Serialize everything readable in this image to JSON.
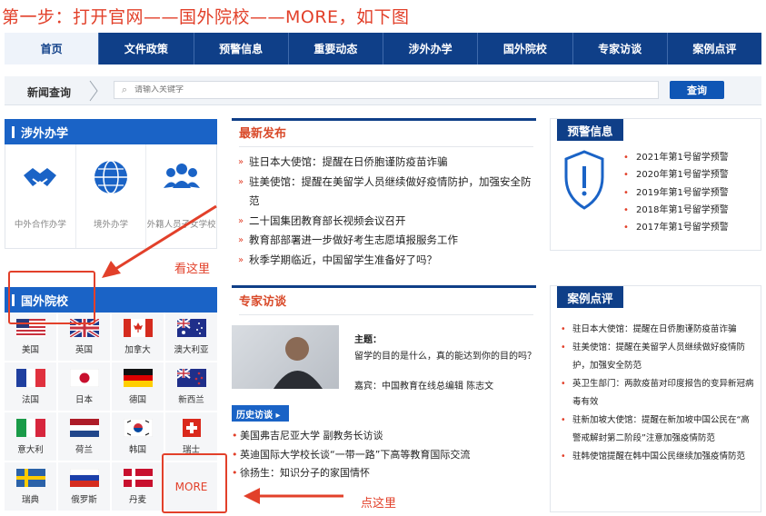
{
  "page_title": "第一步：打开官网——国外院校——MORE，如下图",
  "nav": [
    {
      "label": "首页"
    },
    {
      "label": "文件政策"
    },
    {
      "label": "预警信息"
    },
    {
      "label": "重要动态"
    },
    {
      "label": "涉外办学"
    },
    {
      "label": "国外院校"
    },
    {
      "label": "专家访谈"
    },
    {
      "label": "案例点评"
    }
  ],
  "search": {
    "label": "新闻查询",
    "placeholder": "请输入关键字",
    "button": "查询"
  },
  "abroad": {
    "title": "涉外办学",
    "items": [
      {
        "label": "中外合作办学",
        "icon": "handshake-icon"
      },
      {
        "label": "境外办学",
        "icon": "globe-icon"
      },
      {
        "label": "外籍人员子女学校",
        "icon": "people-icon"
      }
    ]
  },
  "schools": {
    "title": "国外院校",
    "flags": [
      {
        "name": "美国"
      },
      {
        "name": "英国"
      },
      {
        "name": "加拿大"
      },
      {
        "name": "澳大利亚"
      },
      {
        "name": "法国"
      },
      {
        "name": "日本"
      },
      {
        "name": "德国"
      },
      {
        "name": "新西兰"
      },
      {
        "name": "意大利"
      },
      {
        "name": "荷兰"
      },
      {
        "name": "韩国"
      },
      {
        "name": "瑞士"
      },
      {
        "name": "瑞典"
      },
      {
        "name": "俄罗斯"
      },
      {
        "name": "丹麦"
      }
    ],
    "more": "MORE"
  },
  "annotations": {
    "look_here": "看这里",
    "click_here": "点这里",
    "color": "#e2402a"
  },
  "news": {
    "title": "最新发布",
    "items": [
      "驻日本大使馆：提醒在日侨胞谨防疫苗诈骗",
      "驻美使馆：提醒在美留学人员继续做好疫情防护，加强安全防范",
      "二十国集团教育部长视频会议召开",
      "教育部部署进一步做好考生志愿填报服务工作",
      "秋季学期临近，中国留学生准备好了吗？"
    ]
  },
  "expert": {
    "title": "专家访谈",
    "topic_label": "主题：",
    "topic": "留学的目的是什么，真的能达到你的目的吗？",
    "guest": "嘉宾：中国教育在线总编辑 陈志文",
    "history_btn": "历史访谈 ▸",
    "history": [
      "美国弗吉尼亚大学 副教务长访谈",
      "英迪国际大学校长谈“一带一路”下高等教育国际交流",
      "徐扬生：知识分子的家国情怀"
    ]
  },
  "warnings": {
    "title": "预警信息",
    "items": [
      "2021年第1号留学预警",
      "2020年第1号留学预警",
      "2019年第1号留学预警",
      "2018年第1号留学预警",
      "2017年第1号留学预警"
    ]
  },
  "cases": {
    "title": "案例点评",
    "items": [
      "驻日本大使馆：提醒在日侨胞谨防疫苗诈骗",
      "驻美使馆：提醒在美留学人员继续做好疫情防护，加强安全防范",
      "英卫生部门：两款疫苗对印度报告的变异新冠病毒有效",
      "驻新加坡大使馆：提醒在新加坡中国公民在“高警戒解封第二阶段”注意加强疫情防范",
      "驻韩使馆提醒在韩中国公民继续加强疫情防范"
    ]
  },
  "colors": {
    "nav": "#0f3f88",
    "accent": "#1a63c6",
    "red": "#e2402a"
  }
}
